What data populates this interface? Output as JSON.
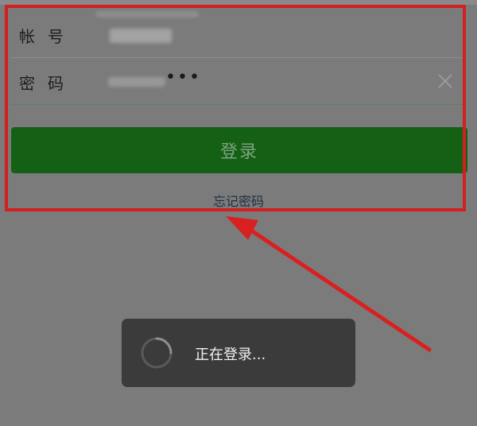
{
  "form": {
    "account_label": "帐号",
    "password_label": "密码",
    "password_mask": "•••",
    "login_button": "登录",
    "forgot_password": "忘记密码"
  },
  "toast": {
    "message": "正在登录..."
  },
  "icons": {
    "clear": "close-icon",
    "spinner": "spinner-icon"
  },
  "colors": {
    "login_button_bg": "#146015",
    "highlight": "#d31f1f",
    "toast_bg": "#3b3b3b"
  }
}
